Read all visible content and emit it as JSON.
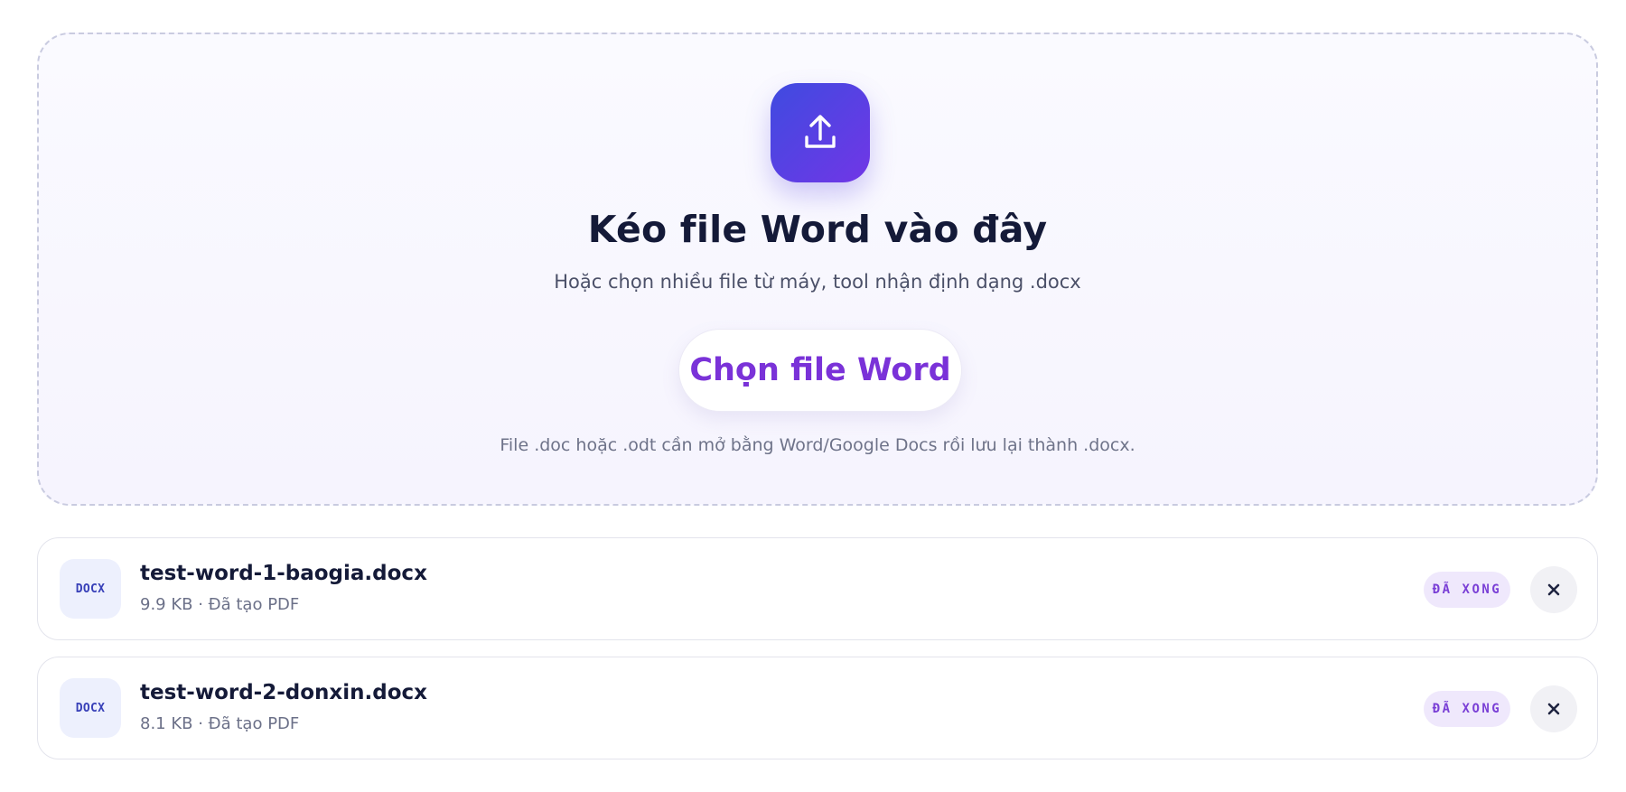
{
  "dropzone": {
    "icon": "upload-icon",
    "title": "Kéo file Word vào đây",
    "subtitle": "Hoặc chọn nhiều file từ máy, tool nhận định dạng .docx",
    "button_label": "Chọn file Word",
    "note": "File .doc hoặc .odt cần mở bằng Word/Google Docs rồi lưu lại thành .docx."
  },
  "files": [
    {
      "type_label": "DOCX",
      "name": "test-word-1-baogia.docx",
      "meta": "9.9 KB · Đã tạo PDF",
      "status": "ĐÃ XONG",
      "remove_icon": "close-icon"
    },
    {
      "type_label": "DOCX",
      "name": "test-word-2-donxin.docx",
      "meta": "8.1 KB · Đã tạo PDF",
      "status": "ĐÃ XONG",
      "remove_icon": "close-icon"
    }
  ],
  "colors": {
    "accent_gradient_start": "#3f4be0",
    "accent_gradient_end": "#7136e6",
    "button_text": "#7a32d8",
    "status_text": "#7a3fd6",
    "status_bg": "#efe8fc",
    "title_text": "#141a38"
  }
}
